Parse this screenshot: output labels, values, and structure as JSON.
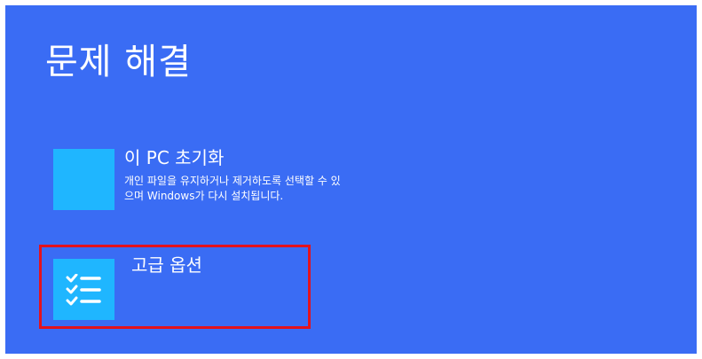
{
  "page": {
    "title": "문제 해결"
  },
  "options": {
    "reset": {
      "title": "이 PC 초기화",
      "description": "개인 파일을 유지하거나 제거하도록 선택할 수 있으며 Windows가 다시 설치됩니다.",
      "icon": "reset-pc-icon"
    },
    "advanced": {
      "title": "고급 옵션",
      "icon": "checklist-icon"
    }
  },
  "colors": {
    "background": "#3a6cf4",
    "tile": "#1fb6ff",
    "highlight": "#e3121c",
    "text": "#ffffff"
  }
}
